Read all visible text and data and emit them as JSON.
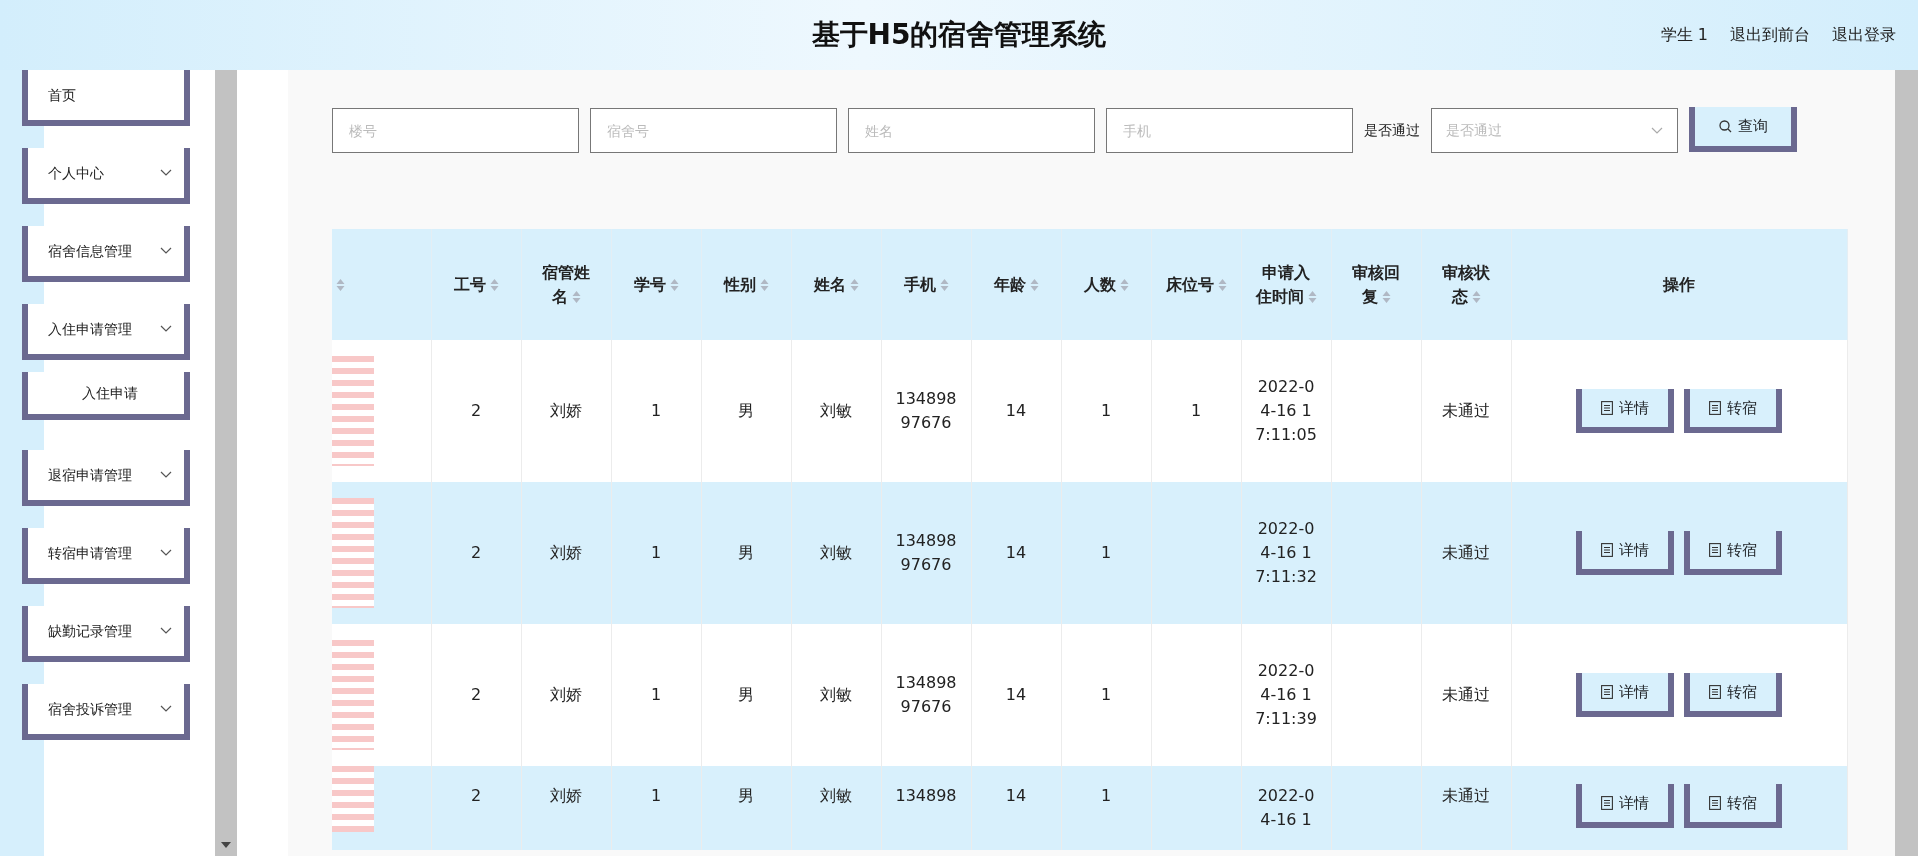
{
  "header": {
    "title": "基于H5的宿舍管理系统",
    "links": [
      "学生 1",
      "退出到前台",
      "退出登录"
    ]
  },
  "sidebar": {
    "items": [
      {
        "label": "首页",
        "kind": "link"
      },
      {
        "label": "个人中心",
        "kind": "menu"
      },
      {
        "label": "宿舍信息管理",
        "kind": "menu"
      },
      {
        "label": "入住申请管理",
        "kind": "menu",
        "children": [
          {
            "label": "入住申请",
            "kind": "link"
          }
        ]
      },
      {
        "label": "退宿申请管理",
        "kind": "menu"
      },
      {
        "label": "转宿申请管理",
        "kind": "menu"
      },
      {
        "label": "缺勤记录管理",
        "kind": "menu"
      },
      {
        "label": "宿舍投诉管理",
        "kind": "menu"
      }
    ]
  },
  "search": {
    "fields": [
      {
        "placeholder": "楼号"
      },
      {
        "placeholder": "宿舍号"
      },
      {
        "placeholder": "姓名"
      },
      {
        "placeholder": "手机"
      }
    ],
    "select_label": "是否通过",
    "select": {
      "placeholder": "是否通过"
    },
    "button": "查询"
  },
  "table": {
    "columns": [
      {
        "sortable": true
      },
      {
        "label": "工号",
        "sortable": true
      },
      {
        "label": "宿管姓名",
        "sortable": true
      },
      {
        "label": "学号",
        "sortable": true
      },
      {
        "label": "性别",
        "sortable": true
      },
      {
        "label": "姓名",
        "sortable": true
      },
      {
        "label": "手机",
        "sortable": true
      },
      {
        "label": "年龄",
        "sortable": true
      },
      {
        "label": "人数",
        "sortable": true
      },
      {
        "label": "床位号",
        "sortable": true
      },
      {
        "label": "申请入住时间",
        "sortable": true
      },
      {
        "label": "审核回复",
        "sortable": true
      },
      {
        "label": "审核状态",
        "sortable": true
      },
      {
        "label": "操作",
        "sortable": false
      }
    ],
    "rows": [
      {
        "cells": [
          null,
          "2",
          "刘娇",
          "1",
          "男",
          "刘敏",
          "13489897676",
          "14",
          "1",
          "1",
          "2022-04-16 17:11:05",
          null,
          "未通过"
        ],
        "actions": [
          "详情",
          "转宿"
        ]
      },
      {
        "cells": [
          null,
          "2",
          "刘娇",
          "1",
          "男",
          "刘敏",
          "13489897676",
          "14",
          "1",
          null,
          "2022-04-16 17:11:32",
          null,
          "未通过"
        ],
        "actions": [
          "详情",
          "转宿"
        ]
      },
      {
        "cells": [
          null,
          "2",
          "刘娇",
          "1",
          "男",
          "刘敏",
          "13489897676",
          "14",
          "1",
          null,
          "2022-04-16 17:11:39",
          null,
          "未通过"
        ],
        "actions": [
          "详情",
          "转宿"
        ]
      },
      {
        "cells": [
          null,
          "2",
          "刘娇",
          "1",
          "男",
          "刘敏",
          "134898",
          "14",
          "1",
          null,
          "2022-04-16 1",
          null,
          "未通过"
        ],
        "actions": [
          "详情",
          "转宿"
        ]
      }
    ]
  }
}
